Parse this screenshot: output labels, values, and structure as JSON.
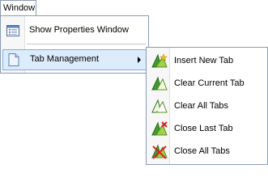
{
  "menubar": {
    "label": "Window"
  },
  "main_menu": {
    "items": [
      {
        "label": "Show Properties Window",
        "icon": "properties-window-icon"
      },
      {
        "label": "Tab Management",
        "icon": "tab-management-icon",
        "has_submenu": true
      }
    ]
  },
  "submenu": {
    "items": [
      {
        "label": "Insert New Tab",
        "icon": "insert-tab-icon"
      },
      {
        "label": "Clear Current Tab",
        "icon": "clear-current-tab-icon"
      },
      {
        "label": "Clear All Tabs",
        "icon": "clear-all-tabs-icon"
      },
      {
        "label": "Close Last Tab",
        "icon": "close-last-tab-icon"
      },
      {
        "label": "Close All Tabs",
        "icon": "close-all-tabs-icon"
      }
    ]
  },
  "colors": {
    "highlight_bg": "#dcecfc",
    "highlight_border": "#80aee0",
    "menu_border": "#8a9bb5",
    "gutter": "#f7f7f7"
  }
}
